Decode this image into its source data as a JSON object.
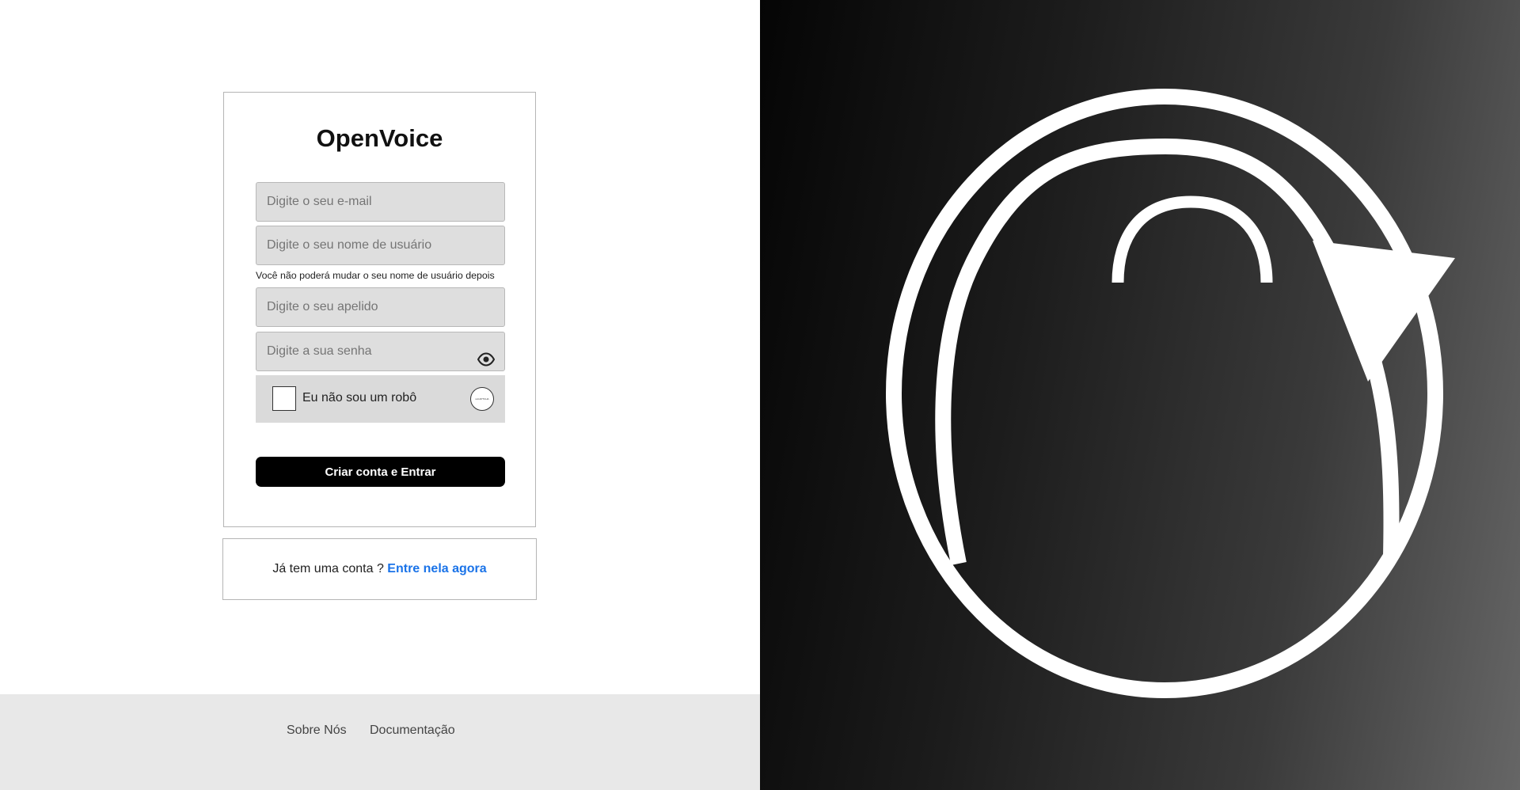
{
  "app": {
    "name": "OpenVoice"
  },
  "signup": {
    "email_placeholder": "Digite o seu e-mail",
    "username_placeholder": "Digite o seu nome de usuário",
    "username_hint": "Você não poderá mudar o seu nome de usuário depois",
    "nickname_placeholder": "Digite o seu apelido",
    "password_placeholder": "Digite a sua senha",
    "captcha_label": "Eu não sou um robô",
    "captcha_logo_text": "reCAPTCHA",
    "submit_label": "Criar conta e Entrar"
  },
  "login_prompt": {
    "text": "Já tem uma conta ? ",
    "link": "Entre nela agora"
  },
  "footer": {
    "about": "Sobre Nós",
    "docs": "Documentação"
  },
  "icons": {
    "password_toggle": "eye-icon",
    "hero": "openvoice-logo"
  },
  "colors": {
    "link": "#1a73e8",
    "button": "#000000",
    "field": "#dedede"
  }
}
